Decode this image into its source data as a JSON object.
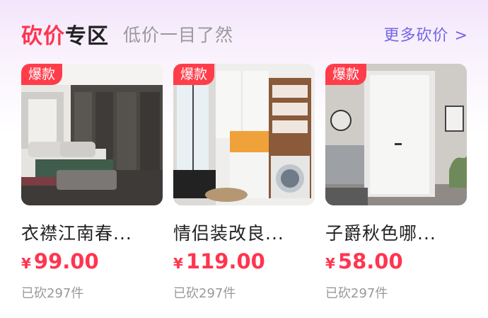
{
  "header": {
    "title_highlight": "砍价",
    "title_rest": "专区",
    "subtitle": "低价一目了然",
    "more_label": "更多砍价",
    "more_chevron": ">"
  },
  "colors": {
    "accent_red": "#ff3550",
    "tag_red": "#ff3d4a",
    "more_purple": "#7566e6",
    "muted_gray": "#999999"
  },
  "products": [
    {
      "tag": "爆款",
      "name": "衣襟江南春...",
      "currency": "¥",
      "price": "99.00",
      "sold": "已砍297件",
      "image": "bedroom-image"
    },
    {
      "tag": "爆款",
      "name": "情侣装改良...",
      "currency": "¥",
      "price": "119.00",
      "sold": "已砍297件",
      "image": "laundry-cabinet-image"
    },
    {
      "tag": "爆款",
      "name": "子爵秋色哪...",
      "currency": "¥",
      "price": "58.00",
      "sold": "已砍297件",
      "image": "white-door-image"
    }
  ]
}
